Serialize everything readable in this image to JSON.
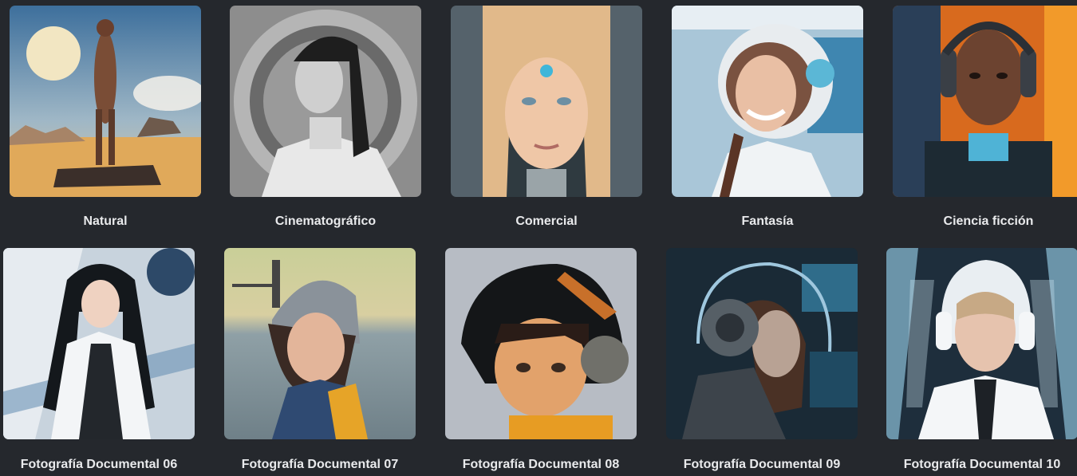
{
  "styles": [
    {
      "name": "Natural",
      "image": "woman-standing-in-desert-image"
    },
    {
      "name": "Cinematográfico",
      "image": "woman-white-suit-monochrome-image"
    },
    {
      "name": "Comercial",
      "image": "cyborg-woman-portrait-image"
    },
    {
      "name": "Fantasía",
      "image": "smiling-astronaut-woman-image"
    },
    {
      "name": "Ciencia ficción",
      "image": "woman-with-headphones-fire-image"
    },
    {
      "name": "Fotografía Documental 06",
      "image": "anime-space-woman-image"
    },
    {
      "name": "Fotografía Documental 07",
      "image": "girl-with-helmet-sea-image"
    },
    {
      "name": "Fotografía Documental 08",
      "image": "girl-space-helmet-painting-image"
    },
    {
      "name": "Fotografía Documental 09",
      "image": "cyborg-woman-profile-image"
    },
    {
      "name": "Fotografía Documental 10",
      "image": "futuristic-woman-headphones-image"
    }
  ],
  "colors": {
    "background": "#25282d",
    "label": "#e9eaec"
  }
}
